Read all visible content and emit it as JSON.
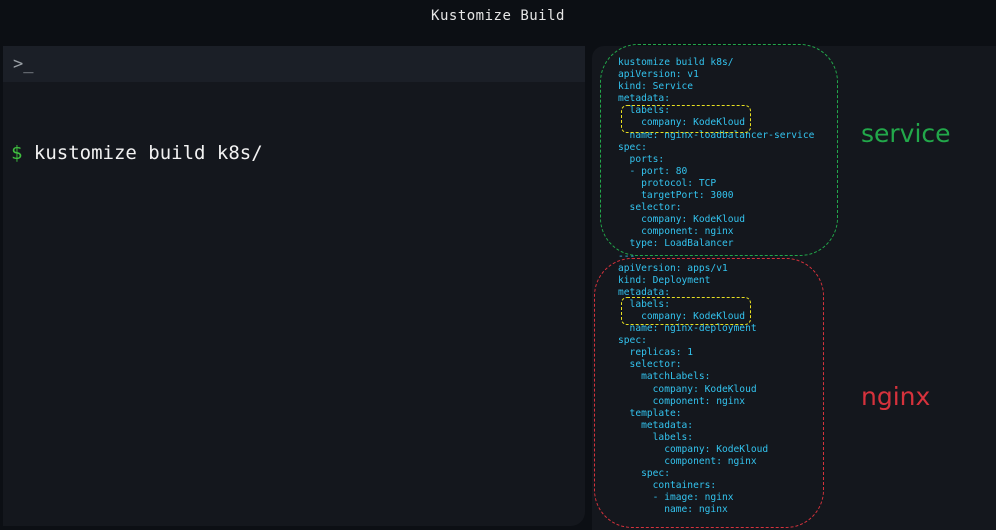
{
  "window": {
    "title": "Kustomize Build"
  },
  "terminal": {
    "prompt_icon": "terminal-icon",
    "prompt_symbol": "$",
    "command": "kustomize build k8s/"
  },
  "output": {
    "yaml": "kustomize build k8s/\napiVersion: v1\nkind: Service\nmetadata:\n  labels:\n    company: KodeKloud\n  name: nginx-loadbalancer-service\nspec:\n  ports:\n  - port: 80\n    protocol: TCP\n    targetPort: 3000\n  selector:\n    company: KodeKloud\n    component: nginx\n  type: LoadBalancer\n---\napiVersion: apps/v1\nkind: Deployment\nmetadata:\n  labels:\n    company: KodeKloud\n  name: nginx-deployment\nspec:\n  replicas: 1\n  selector:\n    matchLabels:\n      company: KodeKloud\n      component: nginx\n  template:\n    metadata:\n      labels:\n        company: KodeKloud\n        component: nginx\n    spec:\n      containers:\n      - image: nginx\n        name: nginx"
  },
  "annotations": {
    "service_label": "service",
    "nginx_label": "nginx",
    "colors": {
      "service": "#22a84a",
      "nginx": "#d6323c",
      "labels_highlight": "#e8e020"
    }
  }
}
